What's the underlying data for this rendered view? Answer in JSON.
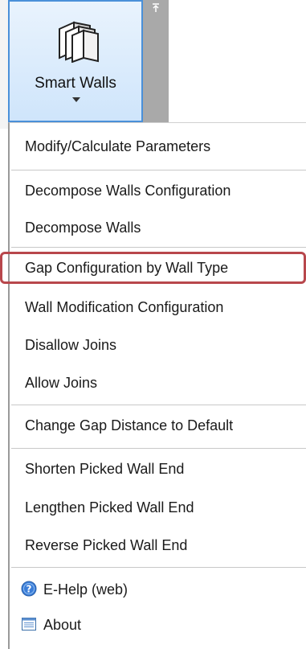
{
  "ribbon": {
    "button_label": "Smart Walls",
    "button_icon": "walls-stack-icon",
    "accent_color": "#4a90d9"
  },
  "menu": {
    "items": [
      {
        "label": "Modify/Calculate Parameters"
      },
      {
        "label": "Decompose Walls Configuration"
      },
      {
        "label": "Decompose Walls"
      },
      {
        "label": "Gap Configuration by Wall Type",
        "highlighted": true
      },
      {
        "label": "Wall Modification Configuration"
      },
      {
        "label": "Disallow Joins"
      },
      {
        "label": "Allow Joins"
      },
      {
        "label": "Change Gap Distance to Default"
      },
      {
        "label": "Shorten Picked Wall End"
      },
      {
        "label": "Lengthen Picked Wall End"
      },
      {
        "label": "Reverse Picked Wall End"
      },
      {
        "label": "E-Help (web)",
        "icon": "help-icon"
      },
      {
        "label": "About",
        "icon": "about-icon"
      }
    ],
    "highlight_color": "#b8474c"
  }
}
